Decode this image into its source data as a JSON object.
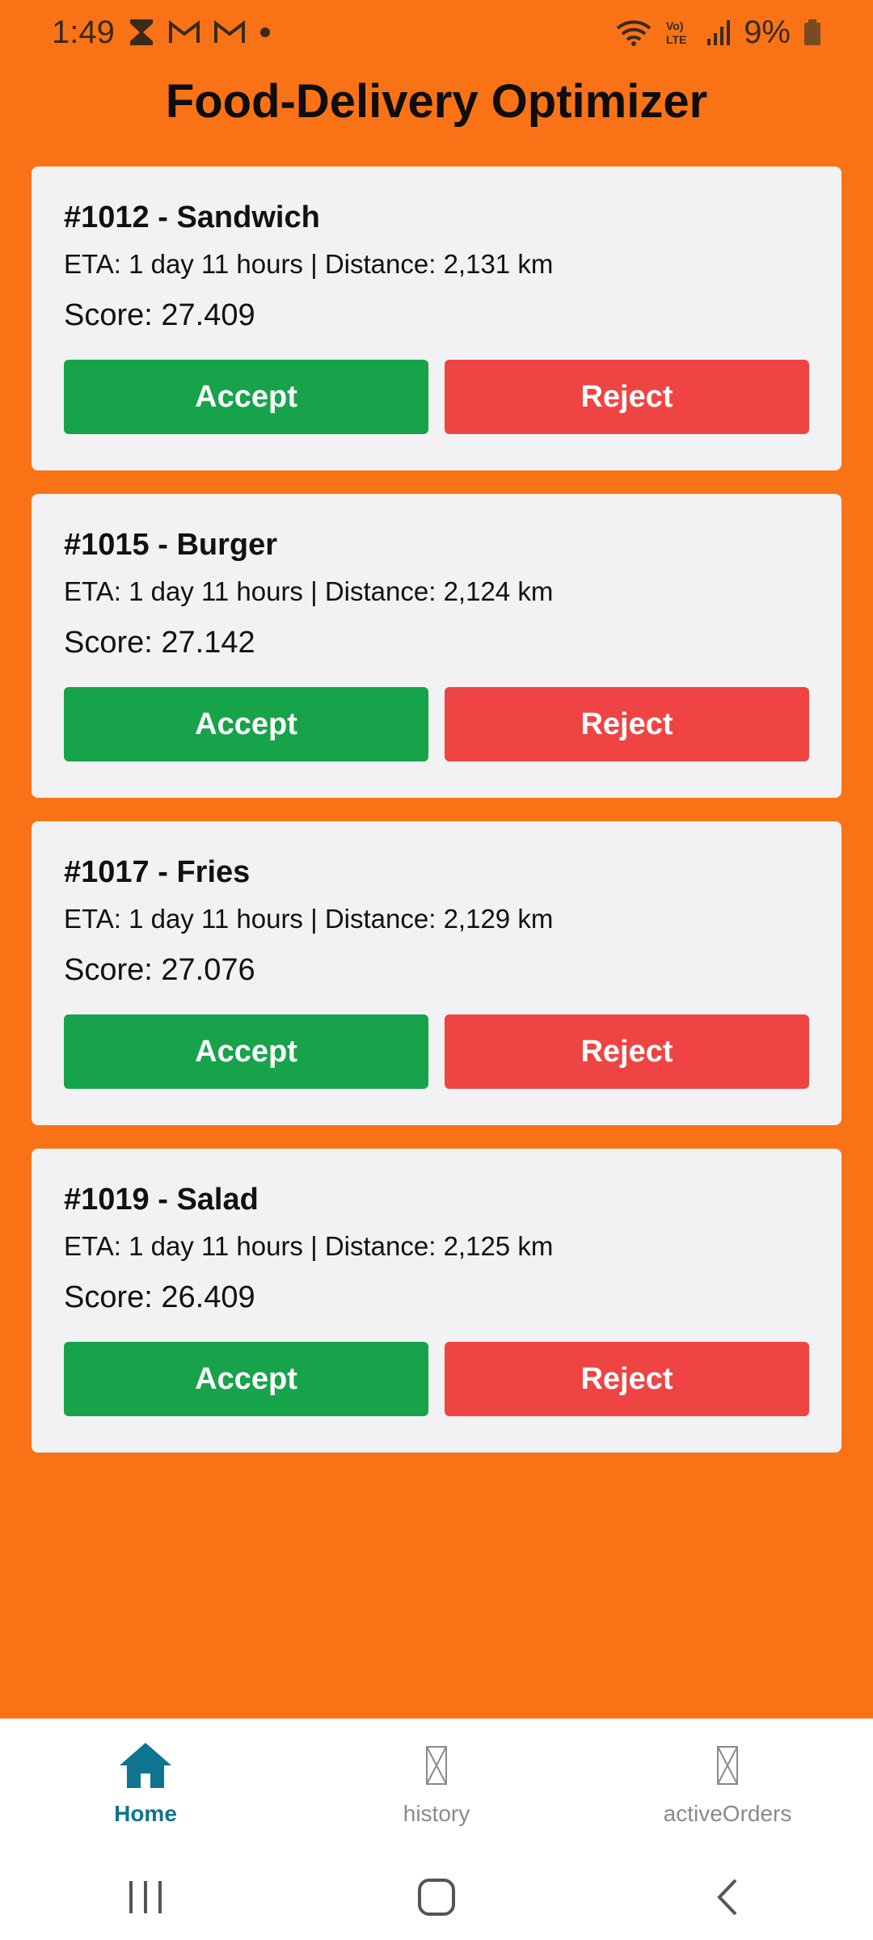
{
  "status_bar": {
    "time": "1:49",
    "battery": "9%",
    "icons_left": [
      "hourglass-icon",
      "gmail-icon",
      "gmail-icon",
      "dot-icon"
    ],
    "icons_right": [
      "wifi-icon",
      "volte-icon",
      "signal-icon",
      "battery-icon"
    ]
  },
  "app": {
    "title": "Food-Delivery Optimizer"
  },
  "orders": [
    {
      "title": "#1012 - Sandwich",
      "meta": "ETA: 1 day 11 hours | Distance: 2,131 km",
      "score": "Score: 27.409",
      "accept": "Accept",
      "reject": "Reject"
    },
    {
      "title": "#1015 - Burger",
      "meta": "ETA: 1 day 11 hours | Distance: 2,124 km",
      "score": "Score: 27.142",
      "accept": "Accept",
      "reject": "Reject"
    },
    {
      "title": "#1017 - Fries",
      "meta": "ETA: 1 day 11 hours | Distance: 2,129 km",
      "score": "Score: 27.076",
      "accept": "Accept",
      "reject": "Reject"
    },
    {
      "title": "#1019 - Salad",
      "meta": "ETA: 1 day 11 hours | Distance: 2,125 km",
      "score": "Score: 26.409",
      "accept": "Accept",
      "reject": "Reject"
    }
  ],
  "bottom_nav": {
    "items": [
      {
        "label": "Home",
        "icon": "home-icon",
        "active": true
      },
      {
        "label": "history",
        "icon": "missing-glyph-icon",
        "active": false
      },
      {
        "label": "activeOrders",
        "icon": "missing-glyph-icon",
        "active": false
      }
    ]
  },
  "colors": {
    "background": "#F97316",
    "card": "#F2F2F4",
    "accept": "#16A34A",
    "reject": "#EF4444",
    "nav_active": "#0E7490",
    "nav_inactive": "#8A8A8A"
  }
}
